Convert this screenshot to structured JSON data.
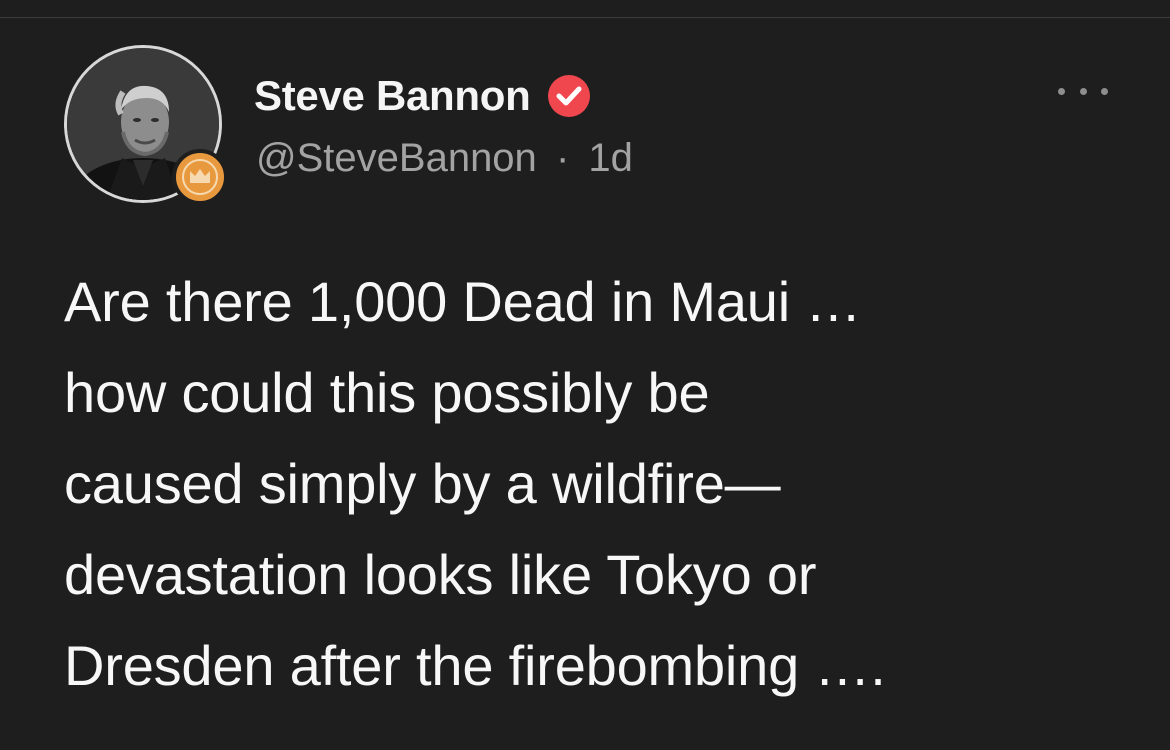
{
  "author": {
    "display_name": "Steve Bannon",
    "handle": "@SteveBannon",
    "separator": "·",
    "time_ago": "1d",
    "verified": true,
    "verified_color": "#f0474e",
    "badge_icon": "crown-icon",
    "badge_color": "#e9993d"
  },
  "menu": {
    "icon": "more-horizontal-icon"
  },
  "post": {
    "lines": [
      "Are there 1,000 Dead in Maui …",
      "how could this possibly be",
      "caused simply by a wildfire—",
      "devastation looks like Tokyo or",
      "Dresden after the firebombing …."
    ]
  }
}
